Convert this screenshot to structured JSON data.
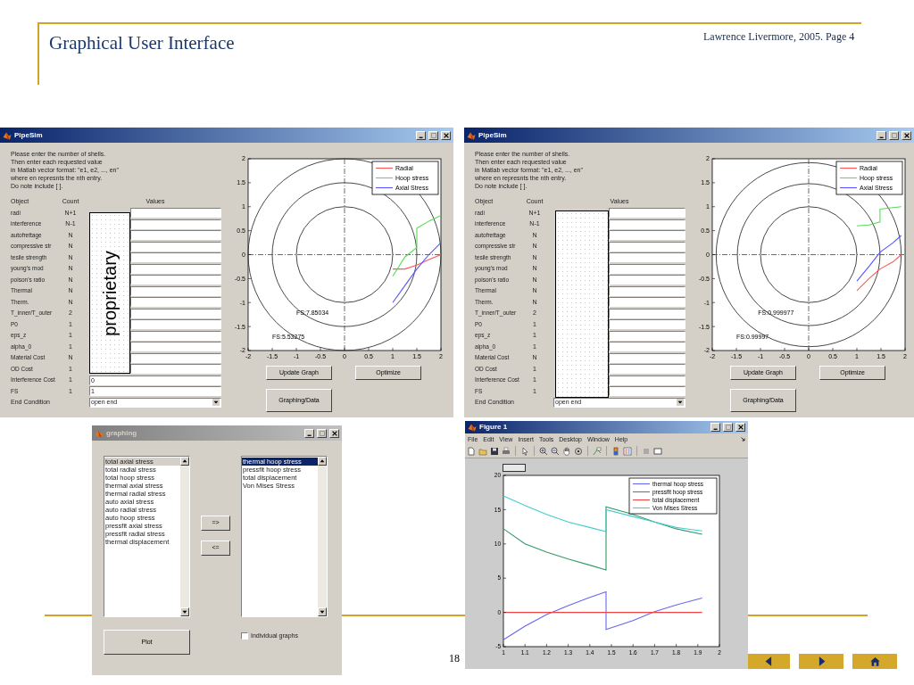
{
  "slide": {
    "title": "Graphical User Interface",
    "header_note": "Lawrence Livermore, 2005. Page 4",
    "page_number": "18"
  },
  "pipesim_windows": [
    {
      "title": "PipeSim",
      "active": true,
      "instructions": [
        "Please enter the number of shells.",
        "Then enter each requested value",
        "in Matlab vector format: \"e1, e2, ..., en\"",
        "where en represnts the nth entry.",
        "Do note include [ ]."
      ],
      "columns": [
        "Object",
        "Count",
        "Values"
      ],
      "rows": [
        {
          "object": "radi",
          "count": "N+1"
        },
        {
          "object": "interference",
          "count": "N-1"
        },
        {
          "object": "autofrettage",
          "count": "N"
        },
        {
          "object": "compressive str",
          "count": "N"
        },
        {
          "object": "tesile strength",
          "count": "N"
        },
        {
          "object": "young's mod",
          "count": "N"
        },
        {
          "object": "poison's ratio",
          "count": "N"
        },
        {
          "object": "Thermal",
          "count": "N"
        },
        {
          "object": "Therm.",
          "count": "N"
        },
        {
          "object": "T_inner/T_outer",
          "count": "2"
        },
        {
          "object": "P0",
          "count": "1"
        },
        {
          "object": "eps_z",
          "count": "1"
        },
        {
          "object": "alpha_0",
          "count": "1"
        },
        {
          "object": "Material Cost",
          "count": "N"
        },
        {
          "object": "OD Cost",
          "count": "1"
        },
        {
          "object": "Interference Cost",
          "count": "1",
          "value": "0"
        },
        {
          "object": "FS",
          "count": "1",
          "value": "1"
        }
      ],
      "end_condition": {
        "label": "End Condition",
        "value": "open end"
      },
      "redacted": true,
      "redaction_label": "proprietary",
      "buttons": [
        "Update Graph",
        "Optimize",
        "Graphing/Data"
      ],
      "chart_data": {
        "type": "line",
        "x": [
          1,
          1.25,
          1.5,
          1.5,
          1.75,
          2
        ],
        "xlim": [
          -2,
          2
        ],
        "ylim": [
          -2,
          2
        ],
        "xticks": [
          -2,
          -1.5,
          -1,
          -0.5,
          0,
          0.5,
          1,
          1.5,
          2
        ],
        "yticks": [
          -2,
          -1.5,
          -1,
          -0.5,
          0,
          0.5,
          1,
          1.5,
          2
        ],
        "series": [
          {
            "name": "Radial",
            "color": "#ff5555",
            "values": [
              -0.3,
              -0.3,
              -0.22,
              -0.22,
              -0.1,
              0
            ]
          },
          {
            "name": "Hoop stress",
            "color": "#55dd55",
            "values": [
              -0.45,
              -0.05,
              0.15,
              0.55,
              0.7,
              0.82
            ]
          },
          {
            "name": "Axial Stress",
            "color": "#5555ff",
            "values": [
              -1,
              -0.65,
              -0.3,
              -0.3,
              0,
              0.25
            ]
          }
        ],
        "legend": "upper right",
        "annotations": [
          "FS:7.85034",
          "FS:5.53275"
        ]
      }
    },
    {
      "title": "PipeSim",
      "active": true,
      "instructions": [
        "Please enter the number of shells.",
        "Then enter each requested value",
        "in Matlab vector format: \"e1, e2, ..., en\"",
        "where en represnts the nth entry.",
        "Do note include [ ]."
      ],
      "columns": [
        "Object",
        "Count",
        "Values"
      ],
      "rows": [
        {
          "object": "radi",
          "count": "N+1"
        },
        {
          "object": "interference",
          "count": "N-1"
        },
        {
          "object": "autofrettage",
          "count": "N"
        },
        {
          "object": "compressive str",
          "count": "N"
        },
        {
          "object": "tesile strength",
          "count": "N"
        },
        {
          "object": "young's mod",
          "count": "N"
        },
        {
          "object": "poison's ratio",
          "count": "N"
        },
        {
          "object": "Thermal",
          "count": "N"
        },
        {
          "object": "Therm.",
          "count": "N"
        },
        {
          "object": "T_inner/T_outer",
          "count": "2"
        },
        {
          "object": "P0",
          "count": "1"
        },
        {
          "object": "eps_z",
          "count": "1"
        },
        {
          "object": "alpha_0",
          "count": "1"
        },
        {
          "object": "Material Cost",
          "count": "N"
        },
        {
          "object": "OD Cost",
          "count": "1"
        },
        {
          "object": "Interference Cost",
          "count": "1"
        },
        {
          "object": "FS",
          "count": "1"
        }
      ],
      "end_condition": {
        "label": "End Condition",
        "value": "open end"
      },
      "redacted": true,
      "buttons": [
        "Update Graph",
        "Optimize",
        "Graphing/Data"
      ],
      "chart_data": {
        "type": "line",
        "x": [
          1,
          1.25,
          1.48,
          1.48,
          1.75,
          1.92
        ],
        "xlim": [
          -2,
          2
        ],
        "ylim": [
          -2,
          2
        ],
        "xticks": [
          -2,
          -1.5,
          -1,
          -0.5,
          0,
          0.5,
          1,
          1.5,
          2
        ],
        "yticks": [
          -2,
          -1.5,
          -1,
          -0.5,
          0,
          0.5,
          1,
          1.5,
          2
        ],
        "series": [
          {
            "name": "Radial",
            "color": "#ff5555",
            "values": [
              -0.75,
              -0.5,
              -0.3,
              -0.3,
              -0.15,
              0
            ]
          },
          {
            "name": "Hoop stress",
            "color": "#55dd55",
            "values": [
              0.6,
              0.62,
              0.68,
              0.95,
              0.98,
              1
            ]
          },
          {
            "name": "Axial Stress",
            "color": "#5555ff",
            "values": [
              -0.55,
              -0.25,
              0.05,
              0.05,
              0.25,
              0.4
            ]
          }
        ],
        "legend": "upper right",
        "annotations": [
          "FS:0.999977",
          "FS:0.99997"
        ]
      }
    }
  ],
  "graphing_window": {
    "title": "graphing",
    "active": false,
    "lists": [
      {
        "focused": false,
        "items": [
          {
            "label": "total axial stress",
            "selected": true
          },
          {
            "label": "total radial stress",
            "selected": false
          },
          {
            "label": "total hoop stress",
            "selected": false
          },
          {
            "label": "thermal axial stress",
            "selected": false
          },
          {
            "label": "thermal radial stress",
            "selected": false
          },
          {
            "label": "auto axial stress",
            "selected": false
          },
          {
            "label": "auto radial stress",
            "selected": false
          },
          {
            "label": "auto hoop stress",
            "selected": false
          },
          {
            "label": "pressfit axial stress",
            "selected": false
          },
          {
            "label": "pressfit radial stress",
            "selected": false
          },
          {
            "label": "thermal displacement",
            "selected": false
          }
        ]
      },
      {
        "focused": true,
        "items": [
          {
            "label": "thermal hoop stress",
            "selected": true
          },
          {
            "label": "pressfit hoop stress",
            "selected": false
          },
          {
            "label": "total displacement",
            "selected": false
          },
          {
            "label": "Von Mises Stress",
            "selected": false
          }
        ]
      }
    ],
    "move_buttons": [
      "=>",
      "<="
    ],
    "plot_button": "Plot",
    "checkbox": {
      "label": "Individual graphs",
      "checked": false
    }
  },
  "figure_window": {
    "title": "Figure 1",
    "active": true,
    "menu": [
      "File",
      "Edit",
      "View",
      "Insert",
      "Tools",
      "Desktop",
      "Window",
      "Help"
    ],
    "chart_data": {
      "type": "line",
      "x": [
        1,
        1.1,
        1.2,
        1.3,
        1.4,
        1.475,
        1.475,
        1.6,
        1.7,
        1.8,
        1.92
      ],
      "xlim": [
        1,
        2
      ],
      "ylim": [
        -5,
        20
      ],
      "xticks": [
        1,
        1.1,
        1.2,
        1.3,
        1.4,
        1.5,
        1.6,
        1.7,
        1.8,
        1.9,
        2
      ],
      "yticks": [
        -5,
        0,
        5,
        10,
        15,
        20
      ],
      "series": [
        {
          "name": "thermal hoop stress",
          "color": "#6666ee",
          "values": [
            -4,
            -2,
            -0.3,
            1,
            2.2,
            3,
            -2.5,
            -1.2,
            0.1,
            1.1,
            2.1
          ]
        },
        {
          "name": "pressfit hoop stress",
          "color": "#339966",
          "values": [
            12.2,
            10,
            8.8,
            7.8,
            6.9,
            6.2,
            15.4,
            14.3,
            13.2,
            12.2,
            11.4
          ]
        },
        {
          "name": "total displacement",
          "color": "#ee4444",
          "values": [
            0,
            0,
            0,
            0,
            0,
            0,
            0,
            0,
            0,
            0,
            0
          ]
        },
        {
          "name": "Von Mises Stress",
          "color": "#44cccc",
          "values": [
            17,
            15.6,
            14.3,
            13.2,
            12.4,
            11.8,
            15,
            14,
            13.2,
            12.4,
            11.9
          ]
        }
      ],
      "legend": "upper right"
    }
  }
}
